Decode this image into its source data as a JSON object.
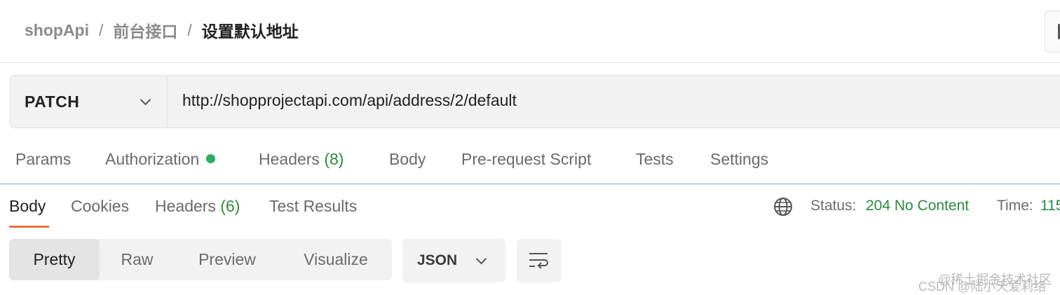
{
  "breadcrumb": {
    "items": [
      "shopApi",
      "前台接口",
      "设置默认地址"
    ],
    "separator": "/"
  },
  "request": {
    "method": "PATCH",
    "url": "http://shopprojectapi.com/api/address/2/default"
  },
  "request_tabs": {
    "params": "Params",
    "authorization": "Authorization",
    "headers": "Headers",
    "headers_count": "(8)",
    "body": "Body",
    "pre_request": "Pre-request Script",
    "tests": "Tests",
    "settings": "Settings"
  },
  "response_tabs": {
    "body": "Body",
    "cookies": "Cookies",
    "headers": "Headers",
    "headers_count": "(6)",
    "test_results": "Test Results"
  },
  "status": {
    "label": "Status:",
    "value": "204 No Content",
    "time_label": "Time:",
    "time_value": "115"
  },
  "view_modes": [
    "Pretty",
    "Raw",
    "Preview",
    "Visualize"
  ],
  "format": "JSON",
  "icons": {
    "network": "globe-icon",
    "wrap": "wrap-lines-icon",
    "dropdown": "chevron-down-icon",
    "auth_status": "green-dot"
  },
  "colors": {
    "accent_orange": "#e8703a",
    "status_green": "#2e8b3e",
    "dot_green": "#27ae60",
    "divider_blue": "#7fa6e0"
  },
  "watermark": {
    "line1": "@稀土掘金技术社区",
    "line2": "CSDN @陆小天爱莉络"
  }
}
